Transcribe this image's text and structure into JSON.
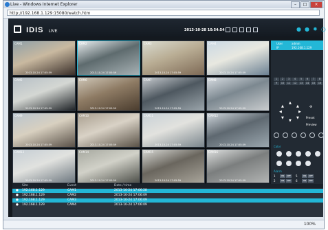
{
  "window": {
    "title": "Live - Windows Internet Explorer",
    "address": "http://192.168.1.129:15080/watch.htm",
    "zoom": "100%"
  },
  "app": {
    "brand": "IDIS",
    "mode": "LIVE",
    "clock": "2013-10-28 10:54:54"
  },
  "cameras": [
    {
      "label": "CAM1",
      "ts": "2013-10-24 17:05:59"
    },
    {
      "label": "CAM2",
      "ts": "2013-10-24 17:05:59"
    },
    {
      "label": "CAM3",
      "ts": "2013-10-24 17:05:59"
    },
    {
      "label": "CAM4",
      "ts": "2013-10-24 17:05:59"
    },
    {
      "label": "CAM5",
      "ts": "2013-10-24 17:05:59"
    },
    {
      "label": "CAM6",
      "ts": "2013-10-24 17:05:59"
    },
    {
      "label": "CAM7",
      "ts": "2013-10-24 17:05:59"
    },
    {
      "label": "CAM8",
      "ts": "2013-10-24 17:05:59"
    },
    {
      "label": "CAM9",
      "ts": "2013-10-24 17:05:59"
    },
    {
      "label": "CAM10",
      "ts": "2013-10-24 17:05:59"
    },
    {
      "label": "CAM11",
      "ts": "2013-10-24 17:05:59"
    },
    {
      "label": "CAM12",
      "ts": "2013-10-24 17:05:59"
    },
    {
      "label": "CAM13",
      "ts": "2013-10-24 17:05:59"
    },
    {
      "label": "CAM14",
      "ts": "2013-10-24 17:05:59"
    },
    {
      "label": "CAM15",
      "ts": "2013-10-24 17:05:59"
    },
    {
      "label": "CAM16",
      "ts": "2013-10-24 17:05:59"
    }
  ],
  "panel": {
    "user_label": "User",
    "user_value": "admin",
    "ip_label": "IP",
    "ip_value": "192.168.1.129",
    "cam_numbers": [
      "1",
      "2",
      "3",
      "4",
      "5",
      "6",
      "7",
      "8",
      "9",
      "10",
      "11",
      "12",
      "13",
      "14",
      "15",
      "16"
    ],
    "preset": "Preset",
    "preview": "Preview",
    "color_title": "Color",
    "alarm_title": "Alarm",
    "alarm_rows": [
      {
        "n": "1",
        "on": "ON",
        "off": "OFF",
        "n2": "5",
        "on2": "ON",
        "off2": "OFF"
      },
      {
        "n": "2",
        "on": "ON",
        "off": "OFF",
        "n2": "6",
        "on2": "ON",
        "off2": "OFF"
      },
      {
        "n": "3",
        "on": "ON",
        "off": "OFF",
        "n2": "7",
        "on2": "ON",
        "off2": "OFF"
      },
      {
        "n": "4",
        "on": "ON",
        "off": "OFF",
        "n2": "8",
        "on2": "ON",
        "off2": "OFF"
      }
    ]
  },
  "log": {
    "headers": {
      "site": "Site",
      "event": "Event",
      "datetime": "Date / time"
    },
    "rows": [
      {
        "site": "192.168.1.129",
        "event": "CAM1",
        "time": "2013-10-24 17:06:28"
      },
      {
        "site": "192.168.1.129",
        "event": "CAM2",
        "time": "2013-10-24 17:06:09"
      },
      {
        "site": "192.168.1.129",
        "event": "CAM3",
        "time": "2013-10-24 17:06:09"
      },
      {
        "site": "192.168.1.129",
        "event": "CAM4",
        "time": "2013-10-24 17:06:09"
      }
    ]
  },
  "colors": {
    "accent": "#23b7d7"
  }
}
